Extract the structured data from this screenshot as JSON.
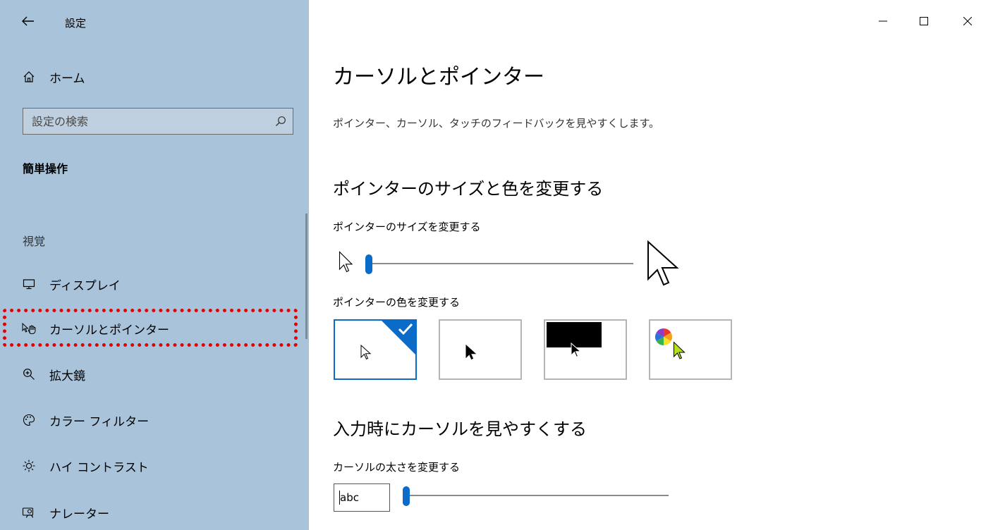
{
  "window": {
    "title": "設定",
    "controls": [
      "minimize",
      "maximize",
      "close"
    ]
  },
  "sidebar": {
    "home_label": "ホーム",
    "search_placeholder": "設定の検索",
    "section_heading": "簡単操作",
    "group_heading": "視覚",
    "items": [
      {
        "label": "ディスプレイ",
        "icon": "monitor-icon"
      },
      {
        "label": "カーソルとポインター",
        "icon": "cursor-hand-icon",
        "highlighted": true
      },
      {
        "label": "拡大鏡",
        "icon": "magnifier-icon"
      },
      {
        "label": "カラー フィルター",
        "icon": "palette-icon"
      },
      {
        "label": "ハイ コントラスト",
        "icon": "sun-icon"
      },
      {
        "label": "ナレーター",
        "icon": "narrator-icon"
      }
    ]
  },
  "main": {
    "title": "カーソルとポインター",
    "description": "ポインター、カーソル、タッチのフィードバックを見やすくします。",
    "pointer_section": {
      "heading": "ポインターのサイズと色を変更する",
      "size_label": "ポインターのサイズを変更する",
      "size_level": 0,
      "color_label": "ポインターの色を変更する",
      "color_options": [
        "white",
        "black",
        "inverted",
        "custom"
      ],
      "selected_color": "white"
    },
    "cursor_section": {
      "heading": "入力時にカーソルを見やすくする",
      "thickness_label": "カーソルの太さを変更する",
      "preview_text": "abc",
      "thickness_level": 0
    }
  },
  "colors": {
    "sidebar_bg": "#a9c4da",
    "accent": "#0a6cc8",
    "highlight_border": "#e20000",
    "custom_pointer": "#b6e01b"
  }
}
